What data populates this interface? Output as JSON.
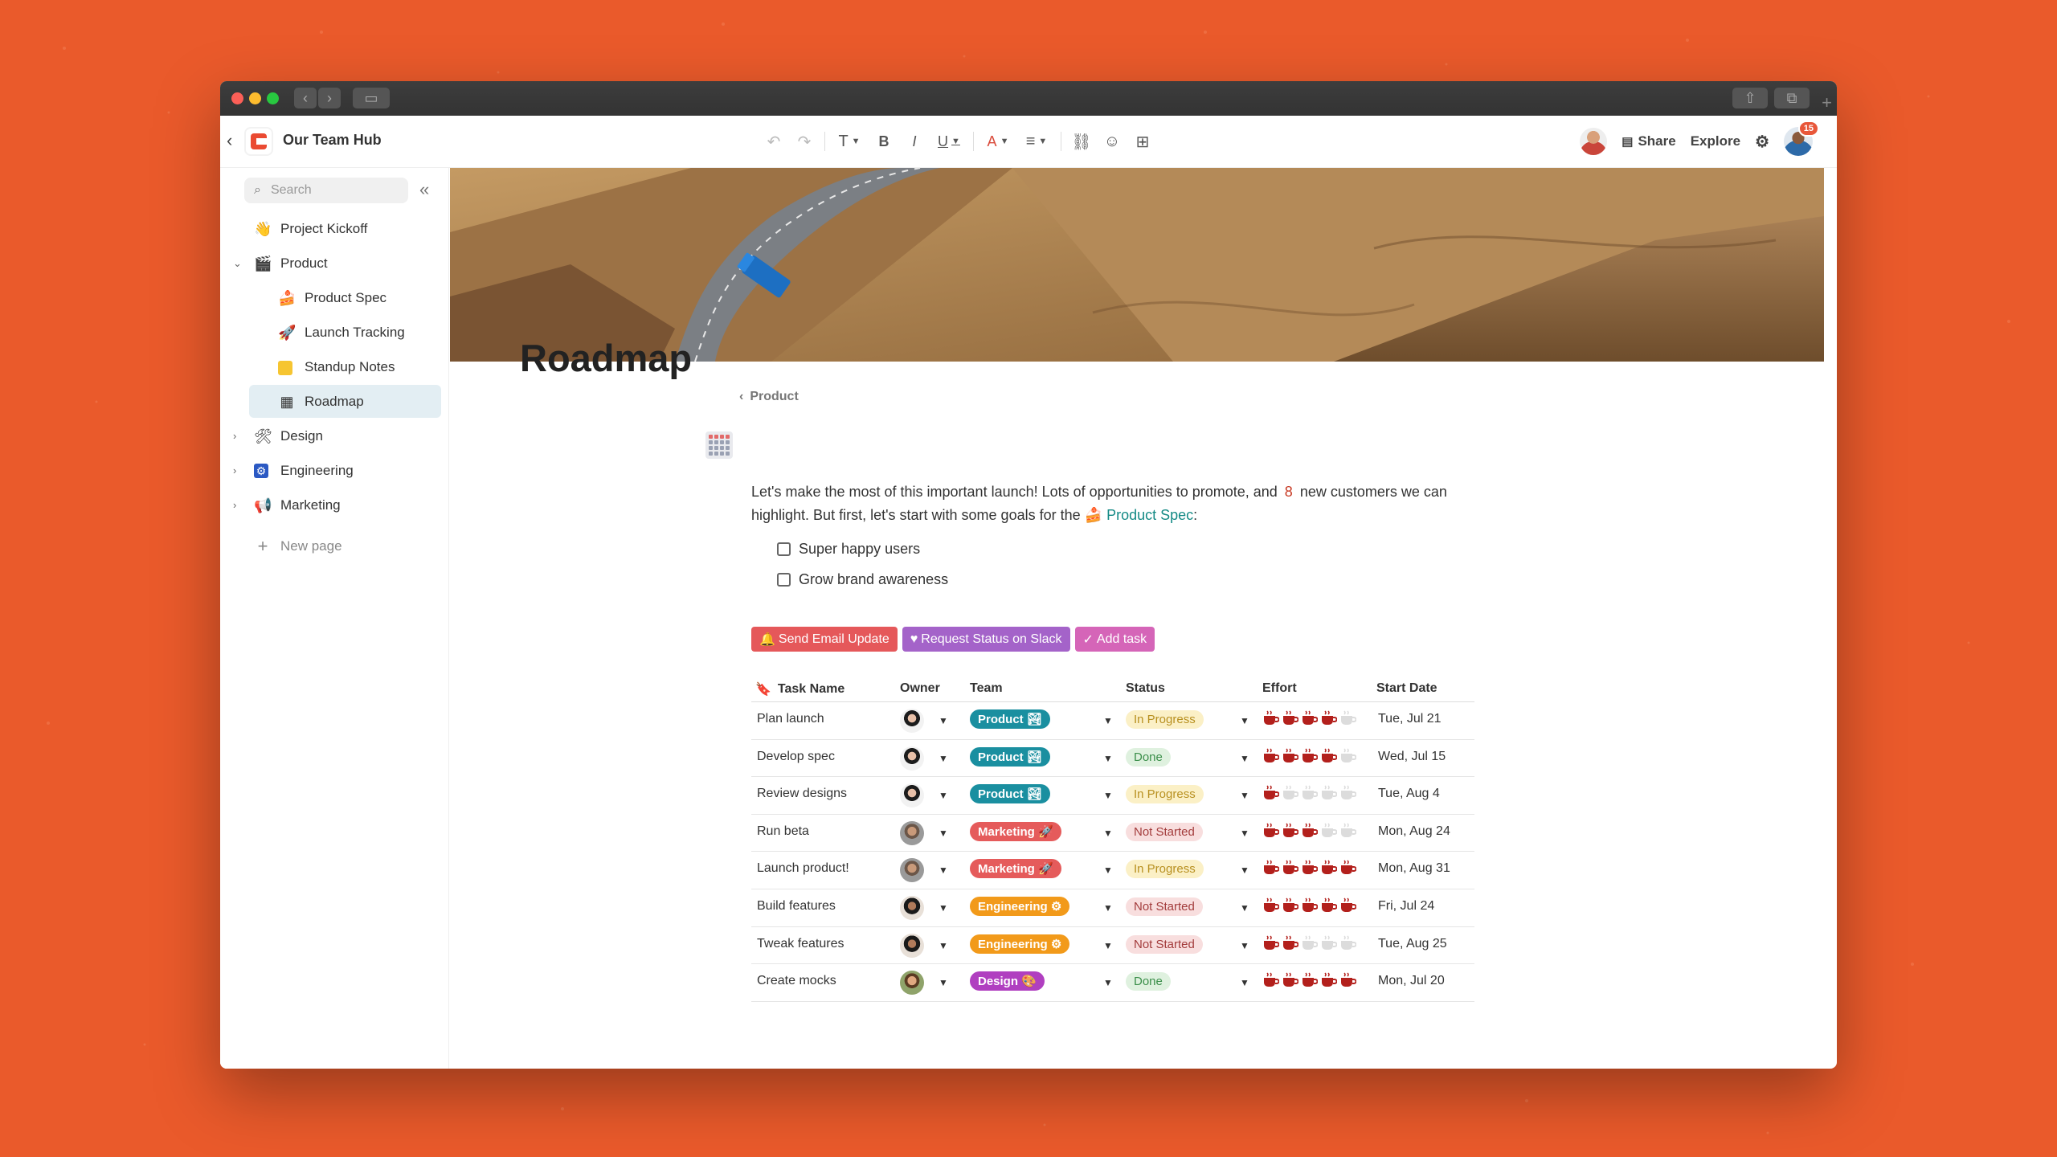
{
  "window": {
    "hub_title": "Our Team Hub",
    "topbar": {
      "share_label": "Share",
      "explore_label": "Explore",
      "notification_count": "15"
    }
  },
  "sidebar": {
    "search_placeholder": "Search",
    "items": [
      {
        "label": "Project Kickoff",
        "icon": "hand-wave-icon",
        "level": 0
      },
      {
        "label": "Product",
        "icon": "clapper-board-icon",
        "level": 0,
        "expanded": true
      },
      {
        "label": "Product Spec",
        "icon": "cake-icon",
        "level": 1
      },
      {
        "label": "Launch Tracking",
        "icon": "rocket-icon",
        "level": 1
      },
      {
        "label": "Standup Notes",
        "icon": "sticky-note-icon",
        "level": 1
      },
      {
        "label": "Roadmap",
        "icon": "calendar-grid-icon",
        "level": 1,
        "active": true
      },
      {
        "label": "Design",
        "icon": "tools-icon",
        "level": 0
      },
      {
        "label": "Engineering",
        "icon": "gear-square-icon",
        "level": 0
      },
      {
        "label": "Marketing",
        "icon": "megaphone-icon",
        "level": 0
      }
    ],
    "new_page_label": "New page"
  },
  "page": {
    "breadcrumb": "Product",
    "title": "Roadmap",
    "intro_part1": "Let's make the most of this important launch! Lots of opportunities to promote, and",
    "intro_number": "8",
    "intro_part2": "new customers we can highlight. But first, let's start with some goals for the",
    "intro_mention": "Product Spec",
    "intro_end": ":",
    "goals": [
      "Super happy users",
      "Grow brand awareness"
    ],
    "actions": [
      {
        "label": "Send Email Update",
        "icon": "bell-icon",
        "color": "#e5585a"
      },
      {
        "label": "Request Status on Slack",
        "icon": "heart-icon",
        "color": "#a463c9"
      },
      {
        "label": "Add task",
        "icon": "check-icon",
        "color": "#d565b8"
      }
    ]
  },
  "table": {
    "headers": {
      "task": "Task Name",
      "owner": "Owner",
      "team": "Team",
      "status": "Status",
      "effort": "Effort",
      "date": "Start Date"
    },
    "rows": [
      {
        "task": "Plan launch",
        "owner": "a",
        "team": "Product 🏞",
        "team_color": "#1a8fa0",
        "status": "In Progress",
        "status_kind": "prog",
        "effort": 4,
        "date": "Tue, Jul 21"
      },
      {
        "task": "Develop spec",
        "owner": "a",
        "team": "Product 🏞",
        "team_color": "#1a8fa0",
        "status": "Done",
        "status_kind": "done",
        "effort": 4,
        "date": "Wed, Jul 15"
      },
      {
        "task": "Review designs",
        "owner": "a",
        "team": "Product 🏞",
        "team_color": "#1a8fa0",
        "status": "In Progress",
        "status_kind": "prog",
        "effort": 1,
        "date": "Tue, Aug 4"
      },
      {
        "task": "Run beta",
        "owner": "b",
        "team": "Marketing 🚀",
        "team_color": "#e55b5b",
        "status": "Not Started",
        "status_kind": "not",
        "effort": 3,
        "date": "Mon, Aug 24"
      },
      {
        "task": "Launch product!",
        "owner": "b",
        "team": "Marketing 🚀",
        "team_color": "#e55b5b",
        "status": "In Progress",
        "status_kind": "prog",
        "effort": 5,
        "date": "Mon, Aug 31"
      },
      {
        "task": "Build features",
        "owner": "c",
        "team": "Engineering ⚙",
        "team_color": "#f29a1a",
        "status": "Not Started",
        "status_kind": "not",
        "effort": 5,
        "date": "Fri, Jul 24"
      },
      {
        "task": "Tweak features",
        "owner": "c",
        "team": "Engineering ⚙",
        "team_color": "#f29a1a",
        "status": "Not Started",
        "status_kind": "not",
        "effort": 2,
        "date": "Tue, Aug 25"
      },
      {
        "task": "Create mocks",
        "owner": "d",
        "team": "Design 🎨",
        "team_color": "#b03fc0",
        "status": "Done",
        "status_kind": "done",
        "effort": 5,
        "date": "Mon, Jul 20"
      }
    ],
    "effort_max": 5
  }
}
